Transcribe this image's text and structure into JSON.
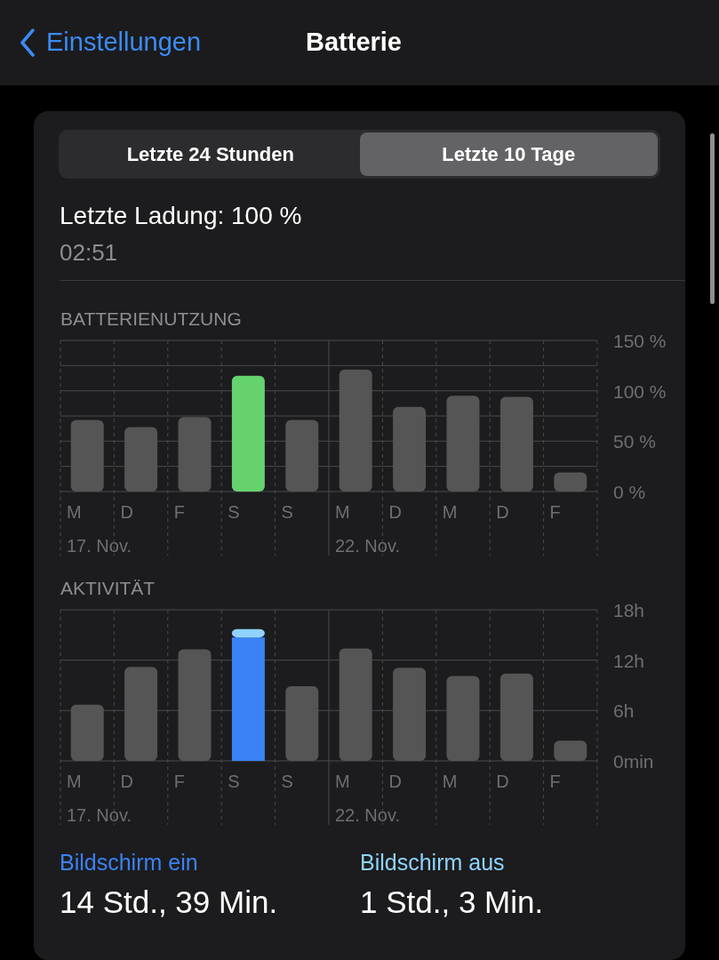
{
  "nav": {
    "back": "Einstellungen",
    "title": "Batterie"
  },
  "tabs": [
    {
      "label": "Letzte 24 Stunden",
      "selected": false
    },
    {
      "label": "Letzte 10 Tage",
      "selected": true
    }
  ],
  "last_charge": {
    "label": "Letzte Ladung: 100 %",
    "time": "02:51"
  },
  "battery_usage": {
    "heading": "BATTERIENUTZUNG",
    "week_labels": [
      "17. Nov.",
      "22. Nov."
    ],
    "chart_data": {
      "type": "bar",
      "stacked": true,
      "categories": [
        "M",
        "D",
        "F",
        "S",
        "S",
        "M",
        "D",
        "M",
        "D",
        "F"
      ],
      "series": [
        {
          "color": "#555555",
          "values": [
            71,
            64,
            74,
            null,
            71,
            121,
            84,
            95,
            94,
            19
          ]
        },
        {
          "color": "#65d26e",
          "values": [
            null,
            null,
            null,
            115,
            null,
            null,
            null,
            null,
            null,
            null
          ]
        }
      ],
      "ylim": [
        0,
        150
      ],
      "yticks": [
        {
          "value": 0,
          "label": "0 %"
        },
        {
          "value": 50,
          "label": "50 %"
        },
        {
          "value": 100,
          "label": "100 %"
        },
        {
          "value": 150,
          "label": "150 %"
        }
      ]
    }
  },
  "activity": {
    "heading": "AKTIVITÄT",
    "week_labels": [
      "17. Nov.",
      "22. Nov."
    ],
    "chart_data": {
      "type": "bar",
      "stacked": true,
      "categories": [
        "M",
        "D",
        "F",
        "S",
        "S",
        "M",
        "D",
        "M",
        "D",
        "F"
      ],
      "series": [
        {
          "color": "#555555",
          "values": [
            6.7,
            11.2,
            13.3,
            null,
            8.9,
            13.4,
            11.1,
            10.1,
            10.4,
            2.4
          ]
        },
        {
          "color": "#3a82f6",
          "values": [
            null,
            null,
            null,
            14.7,
            null,
            null,
            null,
            null,
            null,
            null
          ]
        },
        {
          "color": "#8fd3fe",
          "values": [
            null,
            null,
            null,
            1,
            null,
            null,
            null,
            null,
            null,
            null
          ]
        }
      ],
      "ylim": [
        0,
        18
      ],
      "yticks": [
        {
          "value": 0,
          "label": "0min"
        },
        {
          "value": 6,
          "label": "6h"
        },
        {
          "value": 12,
          "label": "12h"
        },
        {
          "value": 18,
          "label": "18h"
        }
      ]
    }
  },
  "summary": [
    {
      "label": "Bildschirm ein",
      "value": "14 Std., 39 Min.",
      "color": "#3a82f6"
    },
    {
      "label": "Bildschirm aus",
      "value": "1 Std., 3 Min.",
      "color": "#8fd3fe"
    }
  ]
}
